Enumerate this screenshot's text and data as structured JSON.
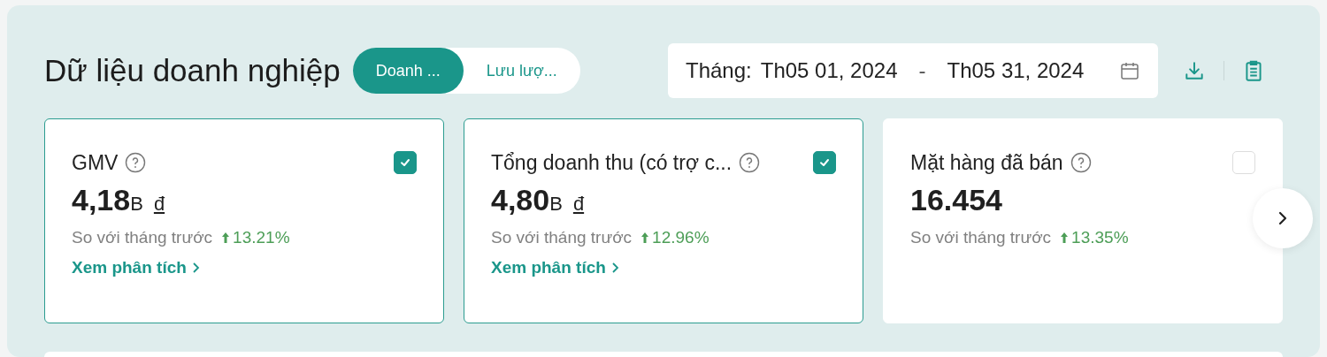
{
  "title": "Dữ liệu doanh nghiệp",
  "tabs": [
    {
      "label": "Doanh ...",
      "selected": true
    },
    {
      "label": "Lưu lượ...",
      "selected": false
    }
  ],
  "date_range": {
    "label": "Tháng:",
    "start": "Th05 01, 2024",
    "separator": "-",
    "end": "Th05 31, 2024"
  },
  "cards": [
    {
      "title": "GMV",
      "checked": true,
      "value": "4,18",
      "unit": "B",
      "currency": "đ",
      "comparison": "So với tháng trước",
      "change": "13.21%",
      "link": "Xem phân tích"
    },
    {
      "title": "Tổng doanh thu (có trợ c...",
      "checked": true,
      "value": "4,80",
      "unit": "B",
      "currency": "đ",
      "comparison": "So với tháng trước",
      "change": "12.96%",
      "link": "Xem phân tích"
    },
    {
      "title": "Mặt hàng đã bán",
      "checked": false,
      "value": "16.454",
      "comparison": "So với tháng trước",
      "change": "13.35%"
    }
  ]
}
